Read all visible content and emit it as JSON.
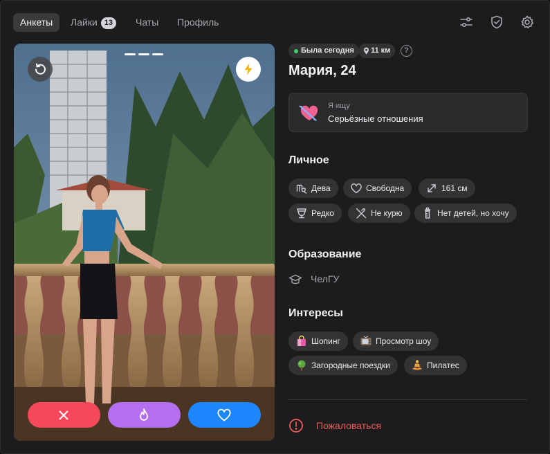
{
  "nav": {
    "tabs": [
      {
        "label": "Анкеты",
        "active": true
      },
      {
        "label": "Лайки",
        "badge": "13"
      },
      {
        "label": "Чаты"
      },
      {
        "label": "Профиль"
      }
    ],
    "right_icons": [
      "filters-icon",
      "shield-check-icon",
      "gear-icon"
    ]
  },
  "photo": {
    "dots_count": 3,
    "rewind_icon": "rewind-icon",
    "boost_icon": "lightning-icon",
    "actions": [
      {
        "name": "dislike",
        "icon": "close-icon",
        "color": "#f5485a"
      },
      {
        "name": "superlike",
        "icon": "flame-icon",
        "color": "#b46ff0"
      },
      {
        "name": "like",
        "icon": "heart-icon",
        "color": "#1e86ff"
      }
    ]
  },
  "profile": {
    "status": "Была сегодня",
    "distance": "11 км",
    "help": "?",
    "name_age": "Мария, 24",
    "seeking": {
      "caption": "Я ищу",
      "value": "Серьёзные отношения"
    },
    "personal_title": "Личное",
    "personal": [
      {
        "label": "Дева",
        "icon": "virgo-icon"
      },
      {
        "label": "Свободна",
        "icon": "heart-outline-icon"
      },
      {
        "label": "161 см",
        "icon": "height-icon"
      },
      {
        "label": "Редко",
        "icon": "wine-glass-icon"
      },
      {
        "label": "Не курю",
        "icon": "no-smoking-icon"
      },
      {
        "label": "Нет детей, но хочу",
        "icon": "baby-bottle-icon"
      }
    ],
    "education_title": "Образование",
    "education": "ЧелГУ",
    "interests_title": "Интересы",
    "interests": [
      {
        "label": "Шопинг",
        "icon": "shopping-bag-icon"
      },
      {
        "label": "Просмотр шоу",
        "icon": "tv-icon"
      },
      {
        "label": "Загородные поездки",
        "icon": "tree-icon"
      },
      {
        "label": "Пилатес",
        "icon": "meditation-icon"
      }
    ],
    "report": "Пожаловаться"
  },
  "colors": {
    "accent_red": "#f5485a",
    "accent_purple": "#b46ff0",
    "accent_blue": "#1e86ff",
    "online": "#3fcf6a",
    "report_red": "#ee5a5a"
  }
}
